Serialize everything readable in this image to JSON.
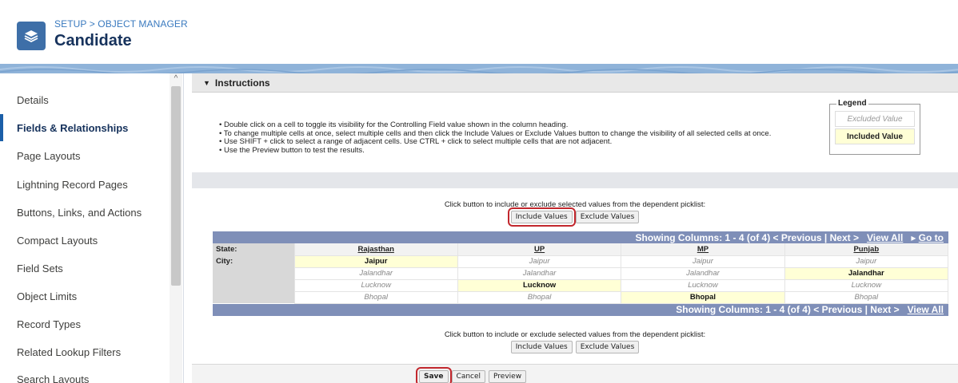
{
  "header": {
    "breadcrumb": "SETUP > OBJECT MANAGER",
    "title": "Candidate",
    "icon": "layers-icon"
  },
  "sidebar": {
    "items": [
      {
        "label": "Details"
      },
      {
        "label": "Fields & Relationships",
        "active": true
      },
      {
        "label": "Page Layouts"
      },
      {
        "label": "Lightning Record Pages"
      },
      {
        "label": "Buttons, Links, and Actions"
      },
      {
        "label": "Compact Layouts"
      },
      {
        "label": "Field Sets"
      },
      {
        "label": "Object Limits"
      },
      {
        "label": "Record Types"
      },
      {
        "label": "Related Lookup Filters"
      },
      {
        "label": "Search Layouts"
      }
    ]
  },
  "instructions": {
    "header": "Instructions",
    "lines": [
      "Double click on a cell to toggle its visibility for the Controlling Field value shown in the column heading.",
      "To change multiple cells at once, select multiple cells and then click the Include Values or Exclude Values button to change the visibility of all selected cells at once.",
      "Use SHIFT + click to select a range of adjacent cells. Use CTRL + click to select multiple cells that are not adjacent.",
      "Use the Preview button to test the results."
    ],
    "legend": {
      "title": "Legend",
      "excluded": "Excluded Value",
      "included": "Included Value"
    }
  },
  "picklist": {
    "hint": "Click button to include or exclude selected values from the dependent picklist:",
    "include_label": "Include Values",
    "exclude_label": "Exclude Values",
    "showing_top": "Showing Columns: 1 - 4 (of 4) < Previous | Next >",
    "showing_bottom": "Showing Columns: 1 - 4 (of 4) < Previous | Next >",
    "view_all": "View All",
    "go_to": "Go to",
    "state_label": "State:",
    "city_label": "City:",
    "columns": [
      "Rajasthan",
      "UP",
      "MP",
      "Punjab"
    ],
    "rows": [
      [
        {
          "v": "Jaipur",
          "inc": true
        },
        {
          "v": "Jaipur",
          "inc": false
        },
        {
          "v": "Jaipur",
          "inc": false
        },
        {
          "v": "Jaipur",
          "inc": false
        }
      ],
      [
        {
          "v": "Jalandhar",
          "inc": false
        },
        {
          "v": "Jalandhar",
          "inc": false
        },
        {
          "v": "Jalandhar",
          "inc": false
        },
        {
          "v": "Jalandhar",
          "inc": true
        }
      ],
      [
        {
          "v": "Lucknow",
          "inc": false
        },
        {
          "v": "Lucknow",
          "inc": true
        },
        {
          "v": "Lucknow",
          "inc": false
        },
        {
          "v": "Lucknow",
          "inc": false
        }
      ],
      [
        {
          "v": "Bhopal",
          "inc": false
        },
        {
          "v": "Bhopal",
          "inc": false
        },
        {
          "v": "Bhopal",
          "inc": true
        },
        {
          "v": "Bhopal",
          "inc": false
        }
      ]
    ]
  },
  "footer": {
    "save": "Save",
    "cancel": "Cancel",
    "preview": "Preview"
  },
  "colors": {
    "highlight": "#c2272d",
    "included_bg": "#ffffd6",
    "grid_bar": "#7f8fb8"
  }
}
